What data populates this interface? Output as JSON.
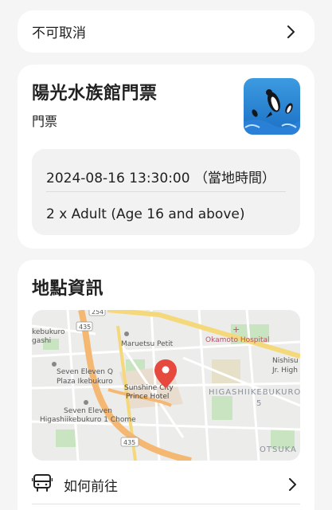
{
  "cancel": {
    "label": "不可取消"
  },
  "ticket": {
    "title": "陽光水族館門票",
    "subtitle": "門票",
    "datetime": "2024-08-16 13:30:00 （當地時間）",
    "quantity": "2 x Adult (Age 16 and above)"
  },
  "location": {
    "title": "地點資訊",
    "directions_label": "如何前往",
    "map_labels": {
      "road_254": "254",
      "road_435_top": "435",
      "road_435_bottom": "435",
      "ikebukuro": "kebukuro",
      "gashi": "gashi",
      "maruetsu": "Maruetsu Petit",
      "okamoto": "Okamoto Hospital",
      "nishisu": "Nishisu",
      "jr_high": "Jr. High",
      "seven_q_1": "Seven Eleven Q",
      "seven_q_2": "Plaza Ikebukuro",
      "sunshine_1": "Sunshine City",
      "sunshine_2": "Prince Hotel",
      "higashiikebukuro": "HIGASHIIKEBUKURO",
      "district_num": "5",
      "seven_h_1": "Seven Eleven",
      "seven_h_2": "Higashiikebukuro 1 Chome",
      "otsuka": "OTSUKA"
    }
  },
  "colors": {
    "accent_pin": "#e64a3f",
    "road_major": "#f5b873",
    "road_yellow": "#f5d87a",
    "park_green": "#c9e4c0",
    "highlight_area": "#e9ddd0"
  }
}
